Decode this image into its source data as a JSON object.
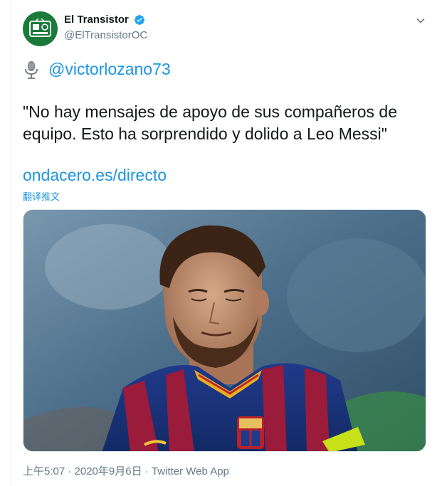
{
  "author": {
    "display_name": "El Transistor",
    "handle": "@ElTransistorOC",
    "avatar_icon": "el-transistor-logo",
    "verified": true
  },
  "tweet": {
    "mention": "@victorlozano73",
    "quote": "\"No hay mensajes de apoyo de sus compañeros de equipo. Esto ha sorprendido y dolido a Leo Messi\"",
    "link": "ondacero.es/directo",
    "translate_label": "翻译推文"
  },
  "footer": {
    "time": "上午5:07 · 2020年9月6日",
    "separator": " · ",
    "source": "Twitter Web App"
  },
  "colors": {
    "link": "#1b95e0",
    "text": "#14171a",
    "muted": "#657786",
    "avatar_bg": "#1a7a3a"
  }
}
